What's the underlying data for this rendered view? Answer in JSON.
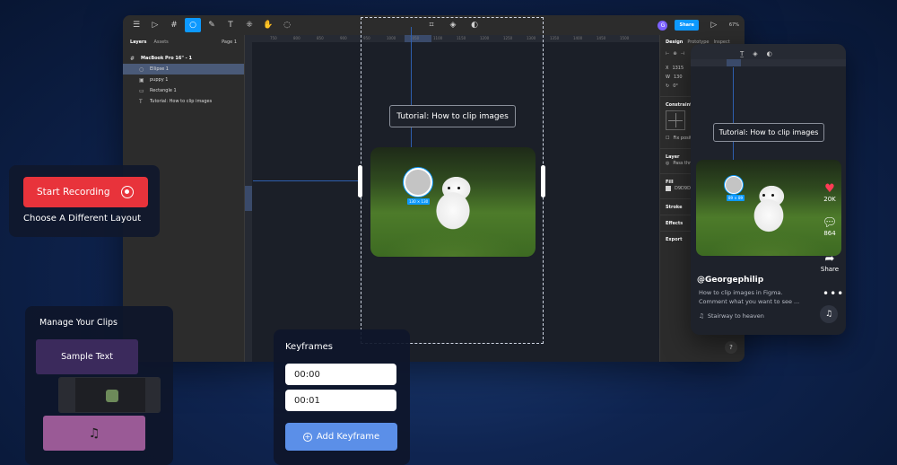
{
  "figma": {
    "toolbar": {
      "share_label": "Share",
      "zoom": "67%",
      "avatar": "G"
    },
    "layers": {
      "tab_layers": "Layers",
      "tab_assets": "Assets",
      "page": "Page 1",
      "items": [
        {
          "label": "MacBook Pro 16\" - 1",
          "icon": "#"
        },
        {
          "label": "Ellipse 1",
          "icon": "○"
        },
        {
          "label": "puppy 1",
          "icon": "▣"
        },
        {
          "label": "Rectangle 1",
          "icon": "▭"
        },
        {
          "label": "Tutorial: How to clip images",
          "icon": "T"
        }
      ]
    },
    "ruler_ticks": [
      "750",
      "800",
      "850",
      "900",
      "950",
      "1000",
      "1050",
      "1100",
      "1150",
      "1200",
      "1250",
      "1300",
      "1350",
      "1400",
      "1450",
      "1500"
    ],
    "props": {
      "tab_design": "Design",
      "tab_prototype": "Prototype",
      "tab_inspect": "Inspect",
      "x": "1315",
      "w": "130",
      "rotation": "0°",
      "constraints": "Constraints",
      "fix_position": "Fix positi",
      "layer": "Layer",
      "pass_through": "Pass thro",
      "fill": "Fill",
      "fill_hex": "D9D9D9",
      "stroke": "Stroke",
      "effects": "Effects",
      "export": "Export"
    },
    "canvas": {
      "tutorial_text": "Tutorial: How to clip images",
      "dim_label": "130 × 130"
    },
    "help": "?"
  },
  "phone": {
    "tutorial_text": "Tutorial: How to clip images",
    "dim_label": "89 × 89",
    "likes": "20K",
    "comments": "864",
    "share_label": "Share",
    "username": "@Georgephilip",
    "caption": "How to clip images in Figma. Comment what you want to see ...",
    "song": "Stairway to heaven"
  },
  "recording": {
    "start_label": "Start Recording",
    "layout_label": "Choose A Different Layout"
  },
  "clips": {
    "title": "Manage Your Clips",
    "text_clip": "Sample Text",
    "audio_icon": "♫"
  },
  "keyframes": {
    "title": "Keyframes",
    "times": [
      "00:00",
      "00:01"
    ],
    "add_label": "Add Keyframe"
  },
  "colors": {
    "record_red": "#e8333b",
    "figma_blue": "#0d99ff",
    "keyframe_blue": "#5b8fe8",
    "clip_purple": "#3b2a5c",
    "clip_pink": "#9a5a96"
  }
}
